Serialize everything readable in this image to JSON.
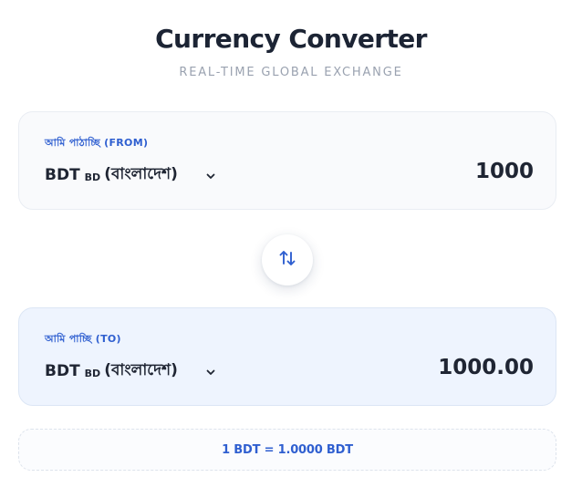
{
  "header": {
    "title": "Currency Converter",
    "subtitle": "REAL-TIME GLOBAL EXCHANGE"
  },
  "from": {
    "label": "আমি পাঠাচ্ছি (FROM)",
    "currency_code": "BDT",
    "currency_flag": "BD",
    "currency_name": "(বাংলাদেশ)",
    "amount": "1000"
  },
  "to": {
    "label": "আমি পাচ্ছি (TO)",
    "currency_code": "BDT",
    "currency_flag": "BD",
    "currency_name": "(বাংলাদেশ)",
    "amount": "1000.00"
  },
  "swap": {
    "icon": "swap-arrows-icon"
  },
  "rate": {
    "text": "1 BDT = 1.0000 BDT"
  },
  "colors": {
    "accent": "#2f5fd0",
    "title": "#1c2434",
    "subtitle": "#9aa2b0",
    "card_from_bg": "#f9fafc",
    "card_to_bg": "#eef4fe"
  }
}
